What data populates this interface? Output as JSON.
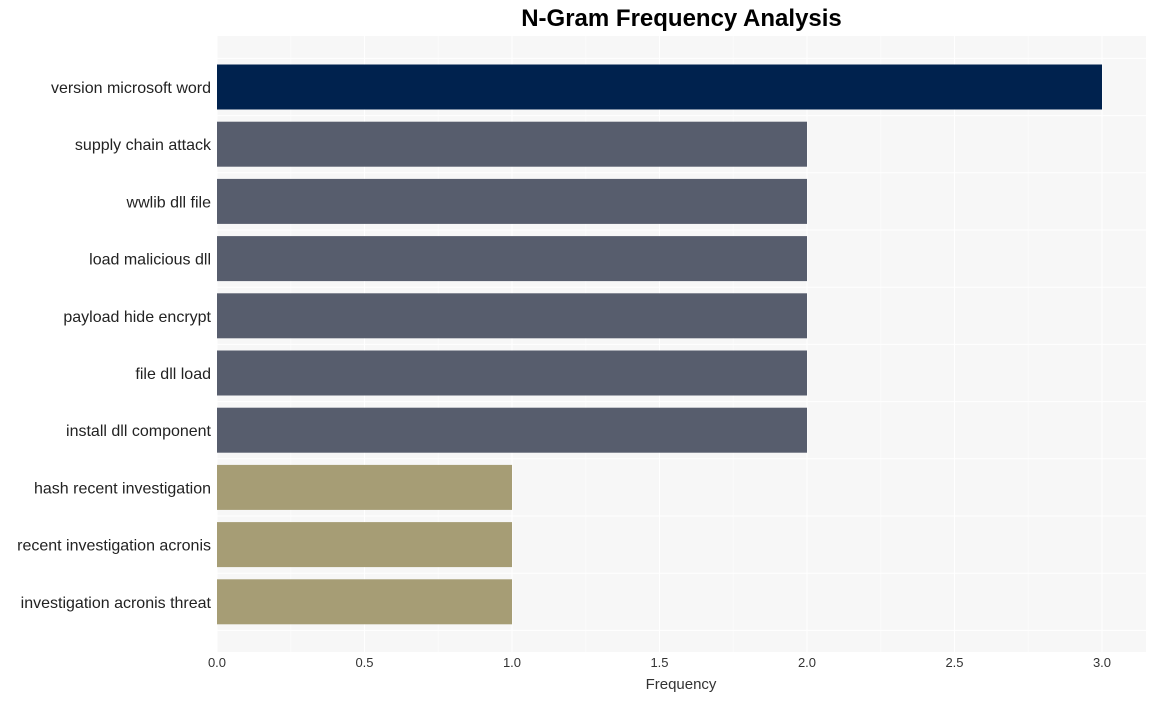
{
  "chart_data": {
    "type": "bar",
    "orientation": "horizontal",
    "title": "N-Gram Frequency Analysis",
    "xlabel": "Frequency",
    "ylabel": "",
    "xlim": [
      0,
      3.15
    ],
    "xticks": [
      0.0,
      0.5,
      1.0,
      1.5,
      2.0,
      2.5,
      3.0
    ],
    "xtick_labels": [
      "0.0",
      "0.5",
      "1.0",
      "1.5",
      "2.0",
      "2.5",
      "3.0"
    ],
    "grid": true,
    "categories": [
      "version microsoft word",
      "supply chain attack",
      "wwlib dll file",
      "load malicious dll",
      "payload hide encrypt",
      "file dll load",
      "install dll component",
      "hash recent investigation",
      "recent investigation acronis",
      "investigation acronis threat"
    ],
    "values": [
      3,
      2,
      2,
      2,
      2,
      2,
      2,
      1,
      1,
      1
    ],
    "bar_colors": [
      "#00224e",
      "#575d6d",
      "#575d6d",
      "#575d6d",
      "#575d6d",
      "#575d6d",
      "#575d6d",
      "#a69d75",
      "#a69d75",
      "#a69d75"
    ]
  },
  "colors": {
    "plot_background": "#f7f7f7",
    "grid": "#ffffff"
  }
}
